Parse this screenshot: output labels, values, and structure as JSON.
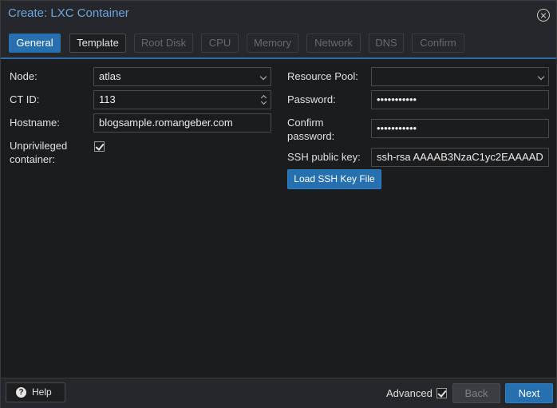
{
  "window": {
    "title": "Create: LXC Container"
  },
  "tabs": [
    {
      "label": "General"
    },
    {
      "label": "Template"
    },
    {
      "label": "Root Disk"
    },
    {
      "label": "CPU"
    },
    {
      "label": "Memory"
    },
    {
      "label": "Network"
    },
    {
      "label": "DNS"
    },
    {
      "label": "Confirm"
    }
  ],
  "form": {
    "node": {
      "label": "Node:",
      "value": "atlas"
    },
    "ct_id": {
      "label": "CT ID:",
      "value": "113"
    },
    "hostname": {
      "label": "Hostname:",
      "value": "blogsample.romangeber.com"
    },
    "unprivileged": {
      "label_line1": "Unprivileged",
      "label_line2": "container:",
      "checked": true
    },
    "resource_pool": {
      "label": "Resource Pool:",
      "value": ""
    },
    "password": {
      "label": "Password:",
      "value": "•••••••••••"
    },
    "confirm_password": {
      "label_line1": "Confirm",
      "label_line2": "password:",
      "value": "•••••••••••"
    },
    "ssh_key": {
      "label": "SSH public key:",
      "value": "ssh-rsa AAAAB3NzaC1yc2EAAAAD"
    },
    "load_ssh_button": "Load SSH Key File"
  },
  "footer": {
    "help_label": "Help",
    "advanced_label": "Advanced",
    "advanced_checked": true,
    "back_label": "Back",
    "next_label": "Next"
  },
  "colors": {
    "accent": "#2670b0",
    "title": "#6ba6e0",
    "background": "#1b1c1e",
    "panel": "#26272a"
  },
  "icons": {
    "close": "close-circle-icon",
    "help": "question-circle-icon",
    "check": "checkmark-icon",
    "dropdown": "chevron-down-icon",
    "spinner": "spinner-arrows-icon"
  }
}
